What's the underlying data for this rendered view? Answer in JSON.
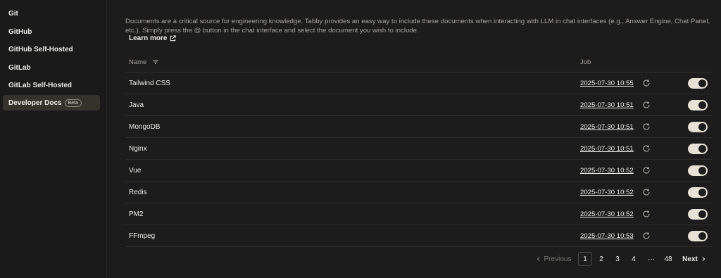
{
  "sidebar": {
    "items": [
      {
        "label": "Git"
      },
      {
        "label": "GitHub"
      },
      {
        "label": "GitHub Self-Hosted"
      },
      {
        "label": "GitLab"
      },
      {
        "label": "GitLab Self-Hosted"
      },
      {
        "label": "Developer Docs",
        "badge": "Beta",
        "active": true
      }
    ]
  },
  "main": {
    "description": "Documents are a critical source for engineering knowledge. Tabby provides an easy way to include these documents when interacting with LLM in chat interfaces (e.g., Answer Engine, Chat Panel, etc.). Simply press the @ button in the chat interface and select the document you wish to include.",
    "learn_more": "Learn more",
    "table": {
      "columns": {
        "name": "Name",
        "job": "Job"
      },
      "rows": [
        {
          "name": "Tailwind CSS",
          "job": "2025-07-30 10:55",
          "enabled": true
        },
        {
          "name": "Java",
          "job": "2025-07-30 10:51",
          "enabled": true
        },
        {
          "name": "MongoDB",
          "job": "2025-07-30 10:51",
          "enabled": true
        },
        {
          "name": "Nginx",
          "job": "2025-07-30 10:51",
          "enabled": true
        },
        {
          "name": "Vue",
          "job": "2025-07-30 10:52",
          "enabled": true
        },
        {
          "name": "Redis",
          "job": "2025-07-30 10:52",
          "enabled": true
        },
        {
          "name": "PM2",
          "job": "2025-07-30 10:52",
          "enabled": true
        },
        {
          "name": "FFmpeg",
          "job": "2025-07-30 10:53",
          "enabled": true
        }
      ]
    },
    "pagination": {
      "previous": "Previous",
      "pages": [
        "1",
        "2",
        "3",
        "4"
      ],
      "ellipsis": "···",
      "last": "48",
      "next": "Next",
      "current": "1"
    }
  },
  "icons": {
    "external_link": "external-link-icon",
    "filter": "filter-icon",
    "refresh": "refresh-icon",
    "chevron_left": "chevron-left-icon",
    "chevron_right": "chevron-right-icon"
  }
}
